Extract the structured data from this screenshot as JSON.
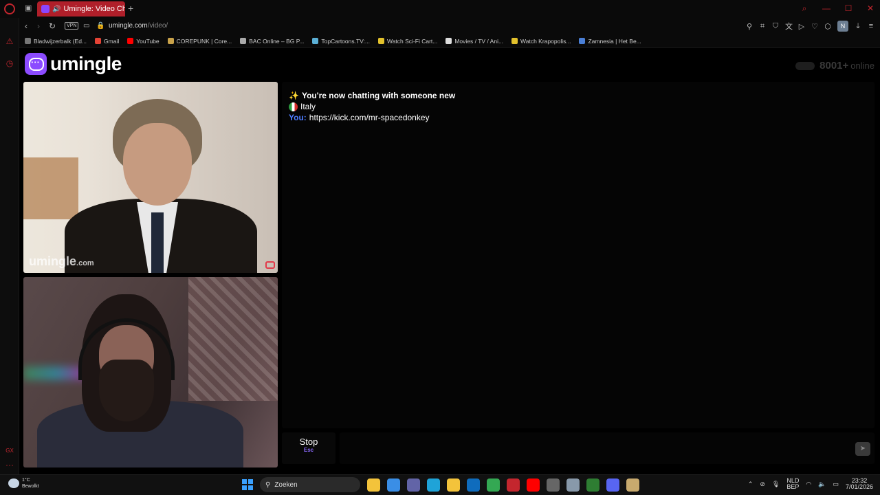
{
  "browser": {
    "tab": {
      "title": "Umingle: Video Chat w"
    },
    "url": {
      "host": "umingle.com",
      "path": "/video/"
    },
    "vpn_label": "VPN",
    "profile_initial": "N",
    "bookmarks": [
      {
        "label": "Bladwijzerbalk (Ed...",
        "color": "#777"
      },
      {
        "label": "Gmail",
        "color": "#e54335"
      },
      {
        "label": "YouTube",
        "color": "#ff0000"
      },
      {
        "label": "COREPUNK | Core...",
        "color": "#c9a24a"
      },
      {
        "label": "BAC Online – BG P...",
        "color": "#aaaaaa"
      },
      {
        "label": "TopCartoons.TV:...",
        "color": "#5bb0d6"
      },
      {
        "label": "Watch Sci-Fi Cart...",
        "color": "#e2c12c"
      },
      {
        "label": "Movies / TV / Ani...",
        "color": "#dddddd"
      },
      {
        "label": "Watch Krapopolis...",
        "color": "#e2c12c"
      },
      {
        "label": "Zamnesia | Het Be...",
        "color": "#4a7fd6"
      }
    ]
  },
  "site": {
    "logo_text": "umingle",
    "online_count": "8001+",
    "online_label": "online",
    "watermark_main": "umingle",
    "watermark_suffix": ".com"
  },
  "chat": {
    "system_message": "You're now chatting with someone new",
    "country": "Italy",
    "you_label": "You:",
    "you_message": "https://kick.com/mr-spacedonkey",
    "stop_label": "Stop",
    "stop_hint": "Esc",
    "input_placeholder": ""
  },
  "taskbar": {
    "weather_temp": "1°C",
    "weather_desc": "Bewolkt",
    "search_label": "Zoeken",
    "lang_top": "NLD",
    "lang_bottom": "BEP",
    "time": "23:32",
    "date": "7/01/2026",
    "apps": [
      {
        "name": "file-explorer-icon",
        "color": "#f3c33b"
      },
      {
        "name": "store-icon",
        "color": "#3a8ee6"
      },
      {
        "name": "teams-icon",
        "color": "#6264a7"
      },
      {
        "name": "edge-icon",
        "color": "#1fa3d8"
      },
      {
        "name": "folder-icon",
        "color": "#f3c33b"
      },
      {
        "name": "outlook-icon",
        "color": "#0f6cbd"
      },
      {
        "name": "chrome-icon",
        "color": "#34a853"
      },
      {
        "name": "opera-icon",
        "color": "#c4262e"
      },
      {
        "name": "youtube-icon",
        "color": "#ff0000"
      },
      {
        "name": "calculator-icon",
        "color": "#666666"
      },
      {
        "name": "steam-icon",
        "color": "#8899aa"
      },
      {
        "name": "green-app-icon",
        "color": "#2e7d32"
      },
      {
        "name": "discord-icon",
        "color": "#5865f2"
      },
      {
        "name": "league-icon",
        "color": "#c8aa6e"
      }
    ]
  }
}
